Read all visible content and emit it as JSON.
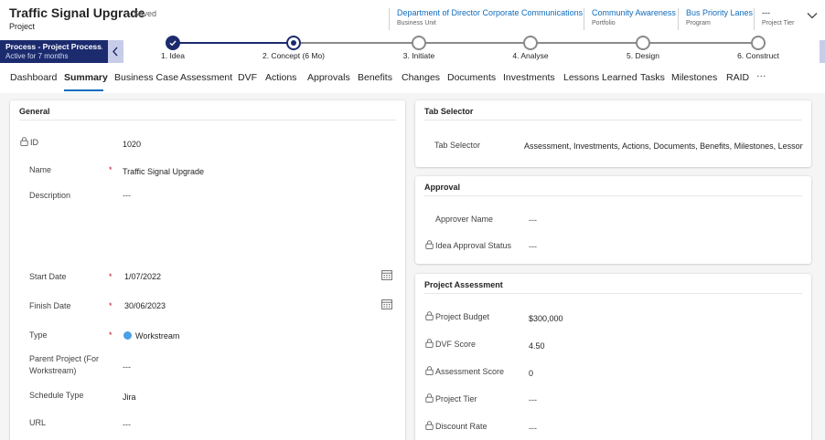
{
  "record": {
    "title": "Traffic Signal Upgrade",
    "saved": "- Saved",
    "type": "Project"
  },
  "header_fields": [
    {
      "value": "Department of Director Corporate Communications",
      "label": "Business Unit"
    },
    {
      "value": "Community Awareness",
      "label": "Portfolio"
    },
    {
      "value": "Bus Priority Lanes",
      "label": "Program"
    },
    {
      "value": "---",
      "label": "Project Tier"
    }
  ],
  "process": {
    "title": "Process - Project Process...",
    "subtitle": "Active for 7 months",
    "stages": [
      {
        "label": "1. Idea",
        "state": "done"
      },
      {
        "label": "2. Concept  (6 Mo)",
        "state": "active"
      },
      {
        "label": "3. Initiate",
        "state": "todo"
      },
      {
        "label": "4. Analyse",
        "state": "todo"
      },
      {
        "label": "5. Design",
        "state": "todo"
      },
      {
        "label": "6. Construct",
        "state": "todo"
      }
    ]
  },
  "tabs": [
    "Dashboard",
    "Summary",
    "Business Case",
    "Assessment",
    "DVF",
    "Actions",
    "Approvals",
    "Benefits",
    "Changes",
    "Documents",
    "Investments",
    "Lessons Learned",
    "Tasks",
    "Milestones",
    "RAID",
    "···"
  ],
  "selected_tab": "Summary",
  "general": {
    "title": "General",
    "id_label": "ID",
    "id_value": "1020",
    "name_label": "Name",
    "name_value": "Traffic Signal Upgrade",
    "description_label": "Description",
    "description_value": "---",
    "start_label": "Start Date",
    "start_value": "1/07/2022",
    "finish_label": "Finish Date",
    "finish_value": "30/06/2023",
    "type_label": "Type",
    "type_value": "Workstream",
    "parent_label": "Parent Project (For Workstream)",
    "parent_value": "---",
    "schedule_label": "Schedule Type",
    "schedule_value": "Jira",
    "url_label": "URL",
    "url_value": "---"
  },
  "tab_selector": {
    "title": "Tab Selector",
    "label": "Tab Selector",
    "value": "Assessment, Investments, Actions, Documents, Benefits, Milestones, Lessons Le..."
  },
  "approval": {
    "title": "Approval",
    "approver_label": "Approver Name",
    "approver_value": "---",
    "status_label": "Idea Approval Status",
    "status_value": "---"
  },
  "assessment": {
    "title": "Project Assessment",
    "budget_label": "Project Budget",
    "budget_value": "$300,000",
    "dvf_label": "DVF Score",
    "dvf_value": "4.50",
    "score_label": "Assessment Score",
    "score_value": "0",
    "tier_label": "Project Tier",
    "tier_value": "---",
    "discount_label": "Discount Rate",
    "discount_value": "---"
  },
  "colors": {
    "accent": "#0f6cbd",
    "process": "#1c2b6e",
    "required": "#c50f1f",
    "lookup": "#4aa0e6"
  }
}
